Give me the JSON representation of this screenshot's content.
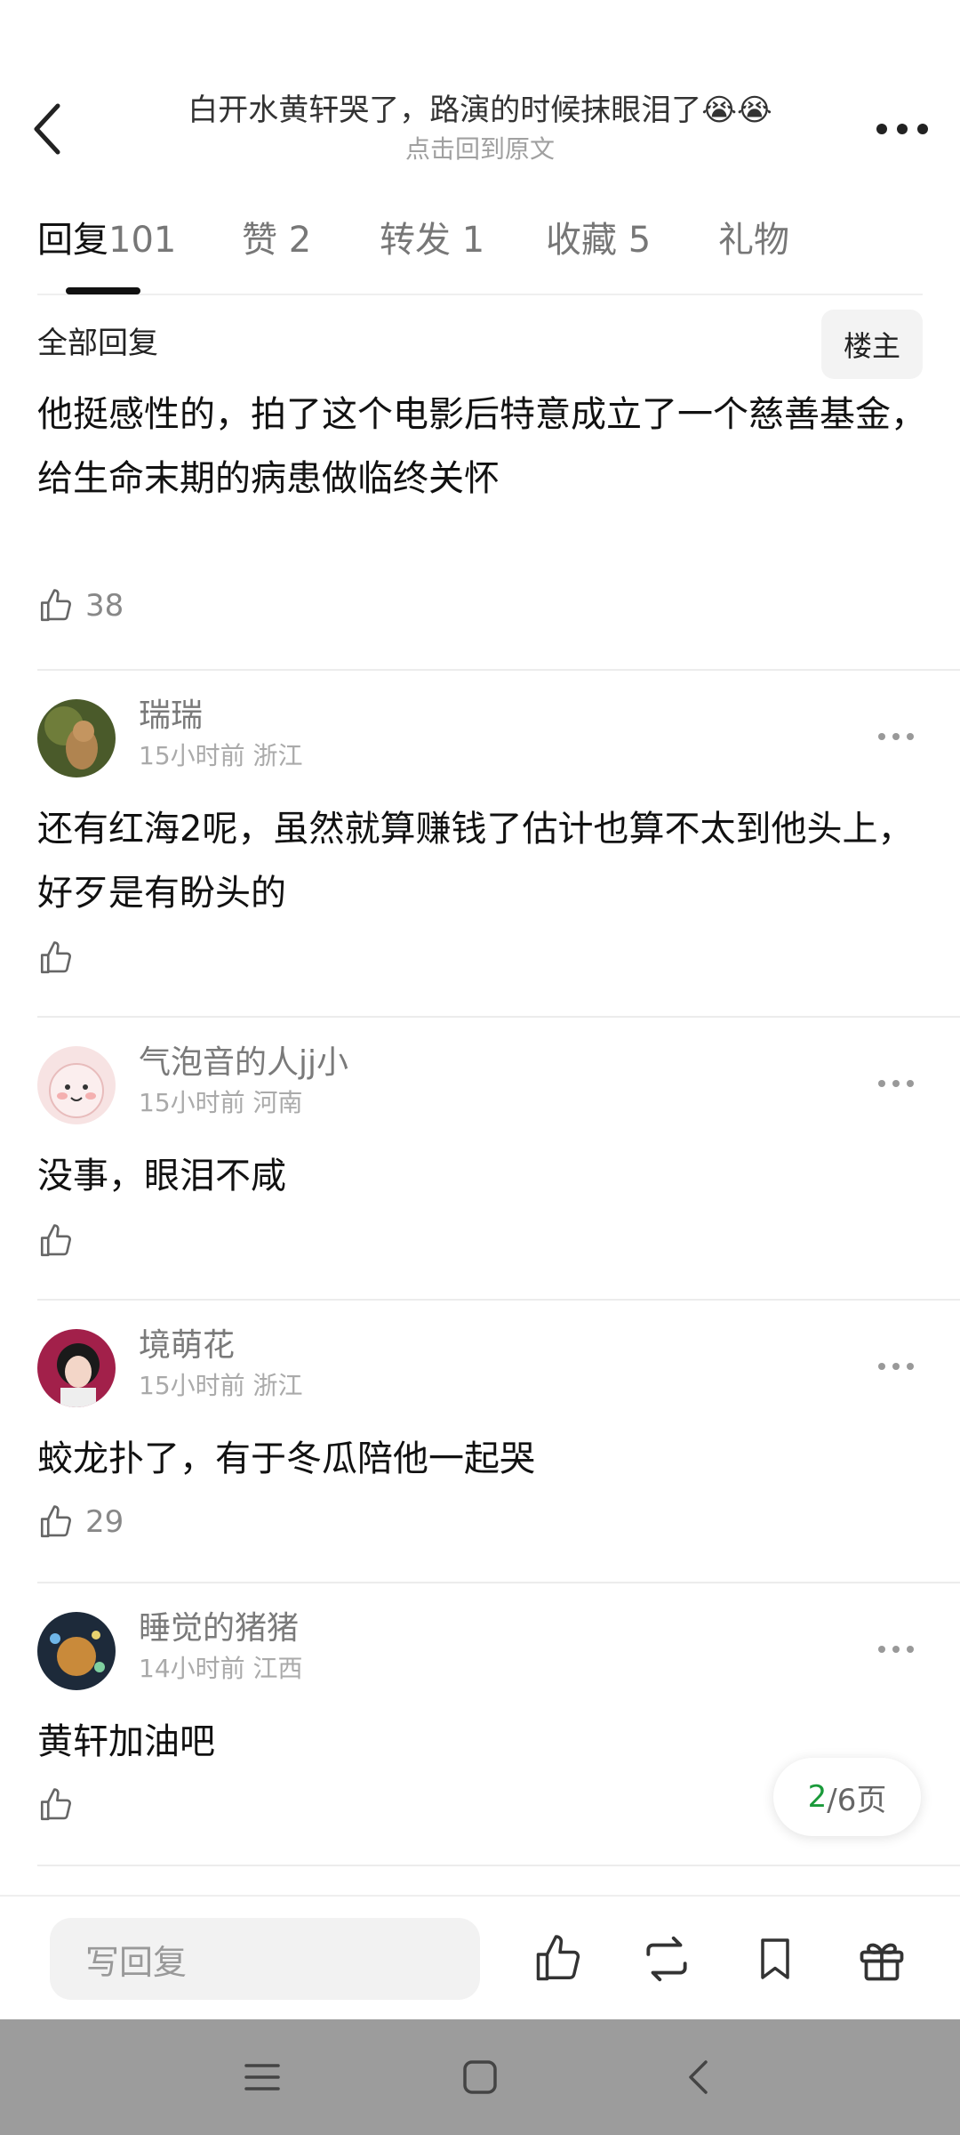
{
  "header": {
    "title": "白开水黄轩哭了，路演的时候抹眼泪了😭😭",
    "subtitle": "点击回到原文"
  },
  "tabs": [
    {
      "label": "回复",
      "count": "101"
    },
    {
      "label": "赞",
      "count": "2"
    },
    {
      "label": "转发",
      "count": "1"
    },
    {
      "label": "收藏",
      "count": "5"
    },
    {
      "label": "礼物",
      "count": ""
    }
  ],
  "main_post": {
    "section_label": "全部回复",
    "op_badge": "楼主",
    "text": "他挺感性的，拍了这个电影后特意成立了一个慈善基金，给生命末期的病患做临终关怀",
    "likes": "38"
  },
  "comments": [
    {
      "name": "瑞瑞",
      "time": "15小时前",
      "location": "浙江",
      "text": "还有红海2呢，虽然就算赚钱了估计也算不太到他头上，好歹是有盼头的",
      "likes": ""
    },
    {
      "name": "气泡音的人jj小",
      "time": "15小时前",
      "location": "河南",
      "text": "没事，眼泪不咸",
      "likes": ""
    },
    {
      "name": "境萌花",
      "time": "15小时前",
      "location": "浙江",
      "text": "蛟龙扑了，有于冬瓜陪他一起哭",
      "likes": "29"
    },
    {
      "name": "睡觉的猪猪",
      "time": "14小时前",
      "location": "江西",
      "text": "黄轩加油吧",
      "likes": ""
    }
  ],
  "pagination": {
    "current": "2",
    "total_text": "/6页"
  },
  "bottom_bar": {
    "placeholder": "写回复"
  },
  "colors": {
    "accent": "#1a9a3a",
    "nav_bar": "#9c9c9c"
  },
  "icons": [
    "back-arrow-icon",
    "more-dots-icon",
    "thumbs-up-icon",
    "repost-icon",
    "bookmark-icon",
    "gift-icon",
    "menu-icon",
    "home-icon",
    "back-nav-icon"
  ]
}
